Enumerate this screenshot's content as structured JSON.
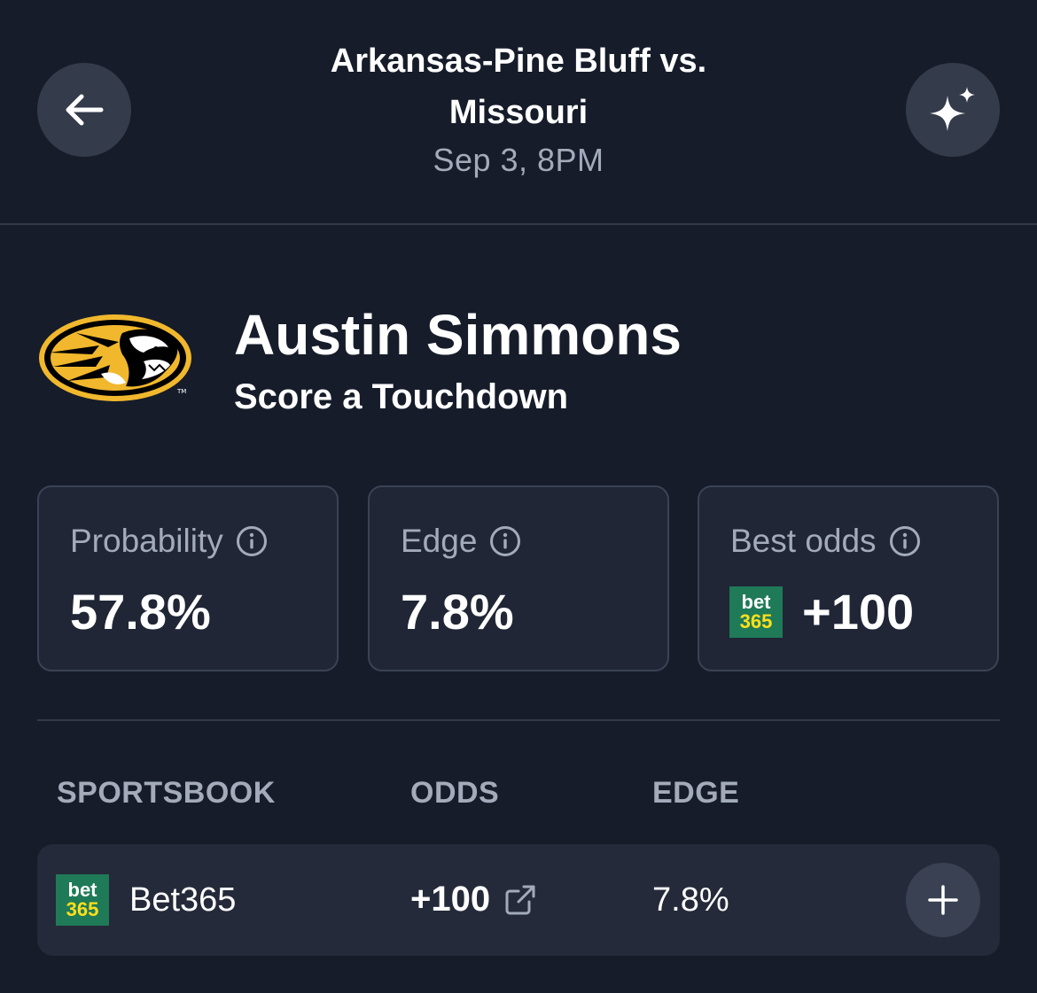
{
  "header": {
    "title_line1": "Arkansas-Pine Bluff vs.",
    "title_line2": "Missouri",
    "date": "Sep 3, 8PM",
    "back_icon": "arrow-left-icon",
    "ai_icon": "sparkles-icon"
  },
  "player": {
    "name": "Austin Simmons",
    "market": "Score a Touchdown",
    "team_logo": "missouri-tigers-logo"
  },
  "stats": {
    "probability": {
      "label": "Probability",
      "value": "57.8%"
    },
    "edge": {
      "label": "Edge",
      "value": "7.8%"
    },
    "best_odds": {
      "label": "Best odds",
      "value": "+100",
      "book_logo_top": "bet",
      "book_logo_bottom": "365"
    }
  },
  "table": {
    "headers": {
      "sportsbook": "SPORTSBOOK",
      "odds": "ODDS",
      "edge": "EDGE"
    },
    "rows": [
      {
        "logo_top": "bet",
        "logo_bottom": "365",
        "book": "Bet365",
        "odds": "+100",
        "edge": "7.8%"
      }
    ]
  },
  "colors": {
    "background": "#161c2a",
    "card": "#202635",
    "muted_text": "#a3abbb",
    "bet365_green": "#1f7a57",
    "bet365_yellow": "#ffdf1b",
    "mizzou_gold": "#f1b82d"
  }
}
